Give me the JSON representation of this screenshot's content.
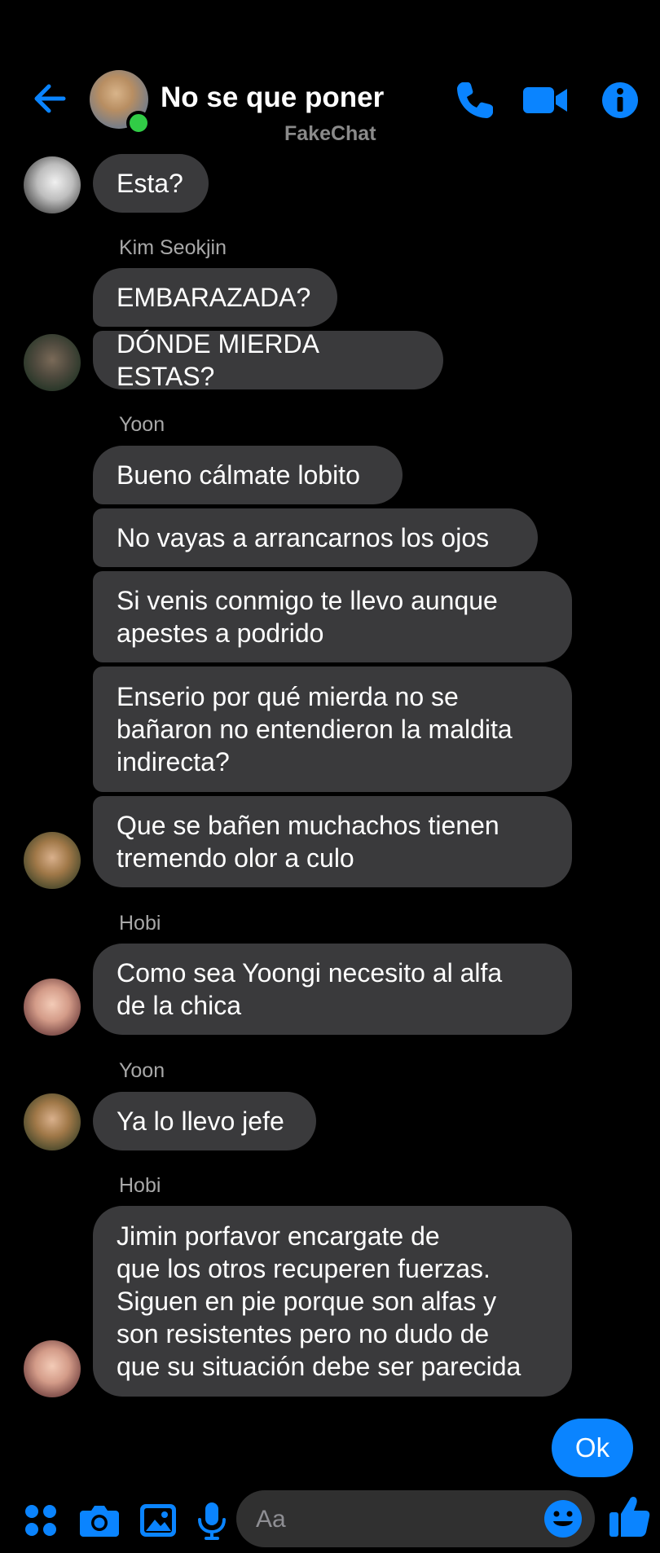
{
  "header": {
    "title": "No se que poner",
    "watermark": "FakeChat",
    "accent": "#0a84ff",
    "online_color": "#31cc46",
    "icons": [
      "back-arrow-icon",
      "phone-icon",
      "video-camera-icon",
      "info-icon"
    ]
  },
  "messages": [
    {
      "text": "Esta?"
    },
    {
      "sender": "Kim Seokjin",
      "text": "EMBARAZADA?"
    },
    {
      "text": "DÓNDE MIERDA ESTAS?"
    },
    {
      "sender": "Yoon",
      "text": "Bueno cálmate lobito"
    },
    {
      "text": "No vayas a arrancarnos los ojos"
    },
    {
      "text": "Si venis conmigo te llevo aunque\napestes a podrido"
    },
    {
      "text": "Enserio por qué mierda no se\nbañaron no entendieron la maldita\nindirecta?"
    },
    {
      "text": "Que se bañen muchachos tienen\ntremendo olor a culo"
    },
    {
      "sender": "Hobi",
      "text": "Como sea Yoongi necesito al alfa\nde la chica"
    },
    {
      "sender": "Yoon",
      "text": "Ya lo llevo jefe"
    },
    {
      "sender": "Hobi",
      "text": "Jimin porfavor encargate de\nque los otros recuperen fuerzas.\nSiguen en pie porque son alfas y\nson resistentes pero no dudo de\nque su situación debe ser parecida"
    }
  ],
  "outgoing": {
    "text": "Ok",
    "color": "#0a84ff"
  },
  "composer": {
    "placeholder": "Aa",
    "icons": [
      "apps-grid-icon",
      "camera-icon",
      "gallery-icon",
      "microphone-icon",
      "emoji-icon",
      "thumbs-up-icon"
    ]
  },
  "colors": {
    "background": "#000000",
    "bubble": "#3a3a3c",
    "label": "#a8a8a8"
  }
}
